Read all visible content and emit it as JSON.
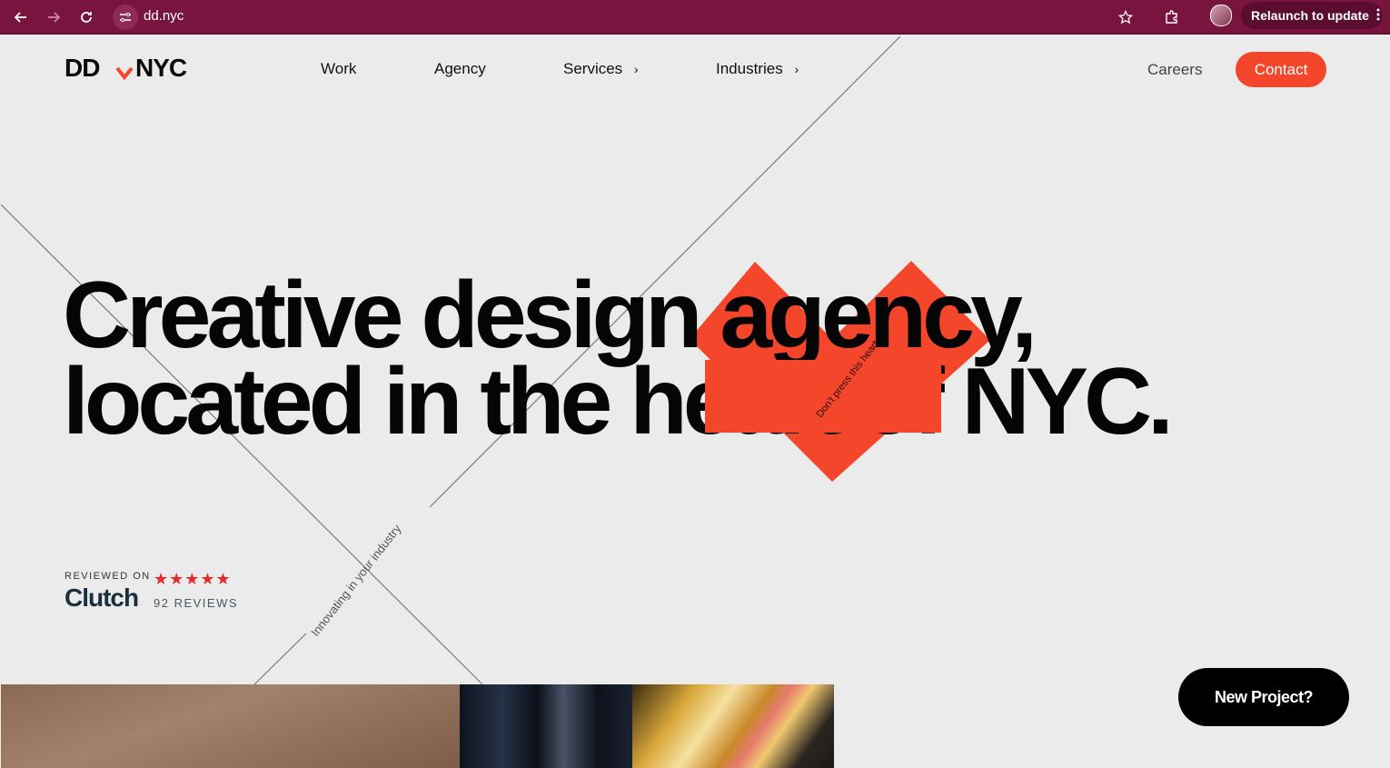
{
  "browser": {
    "url": "dd.nyc",
    "relaunch_label": "Relaunch to update",
    "icons": [
      "back-icon",
      "forward-icon",
      "reload-icon",
      "site-settings-icon",
      "bookmark-star-icon",
      "extensions-icon",
      "profile-avatar",
      "more-menu-icon"
    ]
  },
  "site": {
    "logo_text": "DD.NYC",
    "nav": {
      "work": "Work",
      "agency": "Agency",
      "services": "Services",
      "industries": "Industries",
      "careers": "Careers",
      "contact": "Contact"
    },
    "hero": {
      "line1": "Creative design agency,",
      "line2": "located in the heart of NYC.",
      "heart_label": "Don't press this heart",
      "tagline": "Innovating in your industry"
    },
    "clutch": {
      "reviewed_on": "REVIEWED ON",
      "brand": "Clutch",
      "stars": "★★★★★",
      "reviews": "92 REVIEWS"
    },
    "cta": "New Project?",
    "colors": {
      "accent": "#f4462b",
      "browser_frame": "#78143e",
      "background": "#ebebeb"
    }
  }
}
